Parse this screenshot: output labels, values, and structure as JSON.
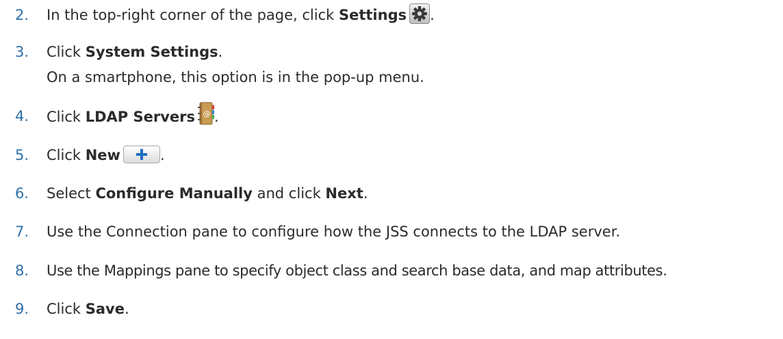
{
  "steps": [
    {
      "number": "2.",
      "pre": "In the top-right corner of the page, click ",
      "bold": "Settings",
      "post": ".",
      "icon": "gear-icon"
    },
    {
      "number": "3.",
      "pre": "Click ",
      "bold": "System Settings",
      "post": ".",
      "note": "On a smartphone, this option is in the pop-up menu."
    },
    {
      "number": "4.",
      "pre": "Click ",
      "bold": "LDAP Servers",
      "post": ".",
      "icon": "address-book-icon"
    },
    {
      "number": "5.",
      "pre": "Click ",
      "bold": "New",
      "post": ".",
      "icon": "plus-icon"
    },
    {
      "number": "6.",
      "pre": "Select ",
      "bold": "Configure Manually",
      "mid": " and click ",
      "bold2": "Next",
      "post": "."
    },
    {
      "number": "7.",
      "text": "Use the Connection pane to configure how the JSS connects to the LDAP server."
    },
    {
      "number": "8.",
      "text": "Use the Mappings pane to specify object class and search base data, and map attributes."
    },
    {
      "number": "9.",
      "pre": "Click ",
      "bold": "Save",
      "post": "."
    }
  ],
  "colors": {
    "step_number": "#2f6fa8",
    "body_text": "#2b2b2b",
    "plus_icon": "#1f6fc0",
    "address_book": "#c89a52"
  }
}
